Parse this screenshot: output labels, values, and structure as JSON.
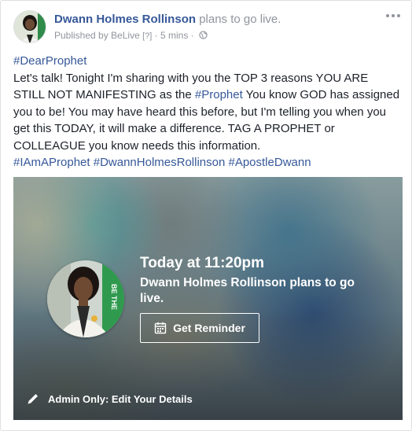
{
  "post": {
    "author": "Dwann Holmes Rollinson",
    "action": "plans to go live.",
    "published_by": "Published by BeLive",
    "help_marker": "[?]",
    "separator": "·",
    "time": "5 mins",
    "privacy_icon": "globe-icon",
    "more_icon": "more-options-icon"
  },
  "message": {
    "hashtag_top": "#DearProphet",
    "text_1": "Let's talk! Tonight I'm sharing with you the TOP 3 reasons YOU ARE STILL NOT MANIFESTING as the ",
    "hashtag_prophet": "#Prophet",
    "text_2": " You know GOD has assigned you to be! You may have heard this before, but I'm telling you when you get this TODAY, it will make a difference. TAG A PROPHET or COLLEAGUE you know needs this information.",
    "hashtags": [
      "#IAmAProphet",
      "#DwannHolmesRollinson",
      "#ApostleDwann"
    ]
  },
  "live_card": {
    "when": "Today at 11:20pm",
    "description": "Dwann Holmes Rollinson plans to go live.",
    "reminder_label": "Get Reminder",
    "reminder_icon": "calendar-icon",
    "admin_label": "Admin Only: Edit Your Details",
    "admin_icon": "pencil-icon",
    "profile_shirt_text": "BE THE"
  },
  "colors": {
    "link": "#365899",
    "muted": "#90949c",
    "text": "#1d2129",
    "overlay_text": "#ffffff"
  }
}
